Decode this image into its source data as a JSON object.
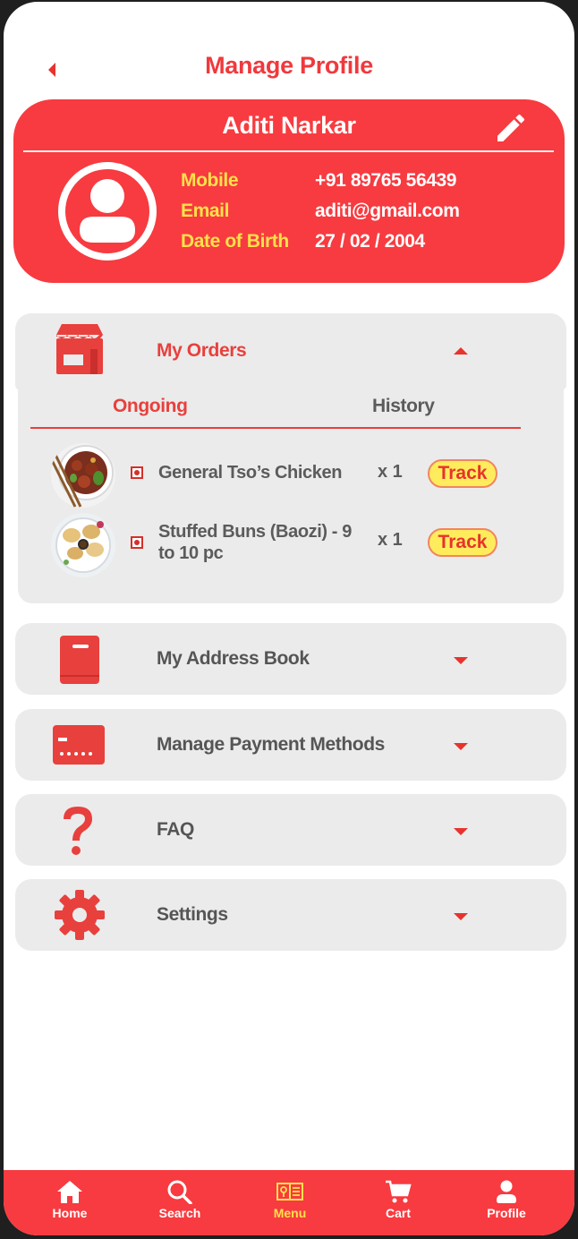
{
  "header": {
    "title": "Manage Profile"
  },
  "profile": {
    "name": "Aditi Narkar",
    "fields": [
      {
        "label": "Mobile",
        "value": "+91 89765 56439"
      },
      {
        "label": "Email",
        "value": "aditi@gmail.com"
      },
      {
        "label": "Date of Birth",
        "value": "27 / 02 / 2004"
      }
    ]
  },
  "orders": {
    "title": "My Orders",
    "tabs": [
      {
        "label": "Ongoing",
        "active": true
      },
      {
        "label": "History",
        "active": false
      }
    ],
    "items": [
      {
        "name": "General Tso’s Chicken",
        "qty": "x 1",
        "action": "Track"
      },
      {
        "name": "Stuffed Buns (Baozi) - 9 to 10 pc",
        "qty": "x 1",
        "action": "Track"
      }
    ]
  },
  "sections": [
    {
      "title": "My Address Book",
      "icon": "address-book-icon"
    },
    {
      "title": "Manage Payment Methods",
      "icon": "credit-card-icon"
    },
    {
      "title": "FAQ",
      "icon": "question-mark-icon"
    },
    {
      "title": "Settings",
      "icon": "gear-icon"
    }
  ],
  "nav": [
    {
      "label": "Home",
      "icon": "home-icon",
      "active": false
    },
    {
      "label": "Search",
      "icon": "search-icon",
      "active": false
    },
    {
      "label": "Menu",
      "icon": "menu-book-icon",
      "active": true
    },
    {
      "label": "Cart",
      "icon": "cart-icon",
      "active": false
    },
    {
      "label": "Profile",
      "icon": "profile-icon",
      "active": false
    }
  ],
  "colors": {
    "primary": "#f73b40",
    "accent_yellow": "#ffe14a",
    "panel_gray": "#ebebeb",
    "text_gray": "#555555"
  }
}
